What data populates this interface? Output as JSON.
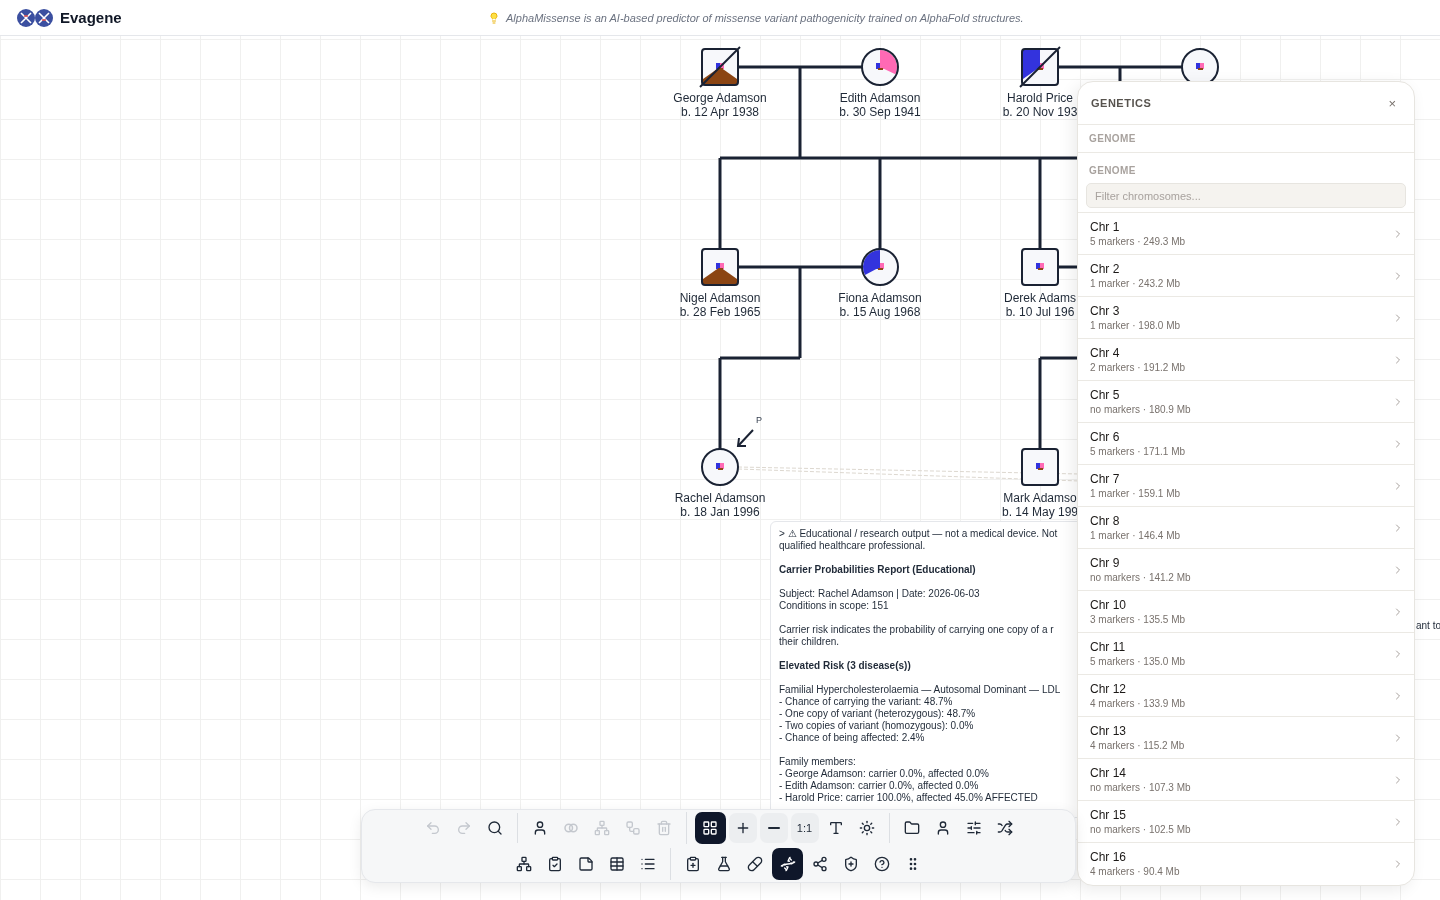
{
  "header": {
    "logo": "Evagene",
    "tip": "AlphaMissense is an AI-based predictor of missense variant pathogenicity trained on AlphaFold structures."
  },
  "pedigree": {
    "individuals": [
      {
        "name": "George Adamson",
        "birth": "b. 12 Apr 1938",
        "kind": "male",
        "deceased": true,
        "shading": {
          "kind": "bottom",
          "color": "#8b4513"
        }
      },
      {
        "name": "Edith Adamson",
        "birth": "b. 30 Sep 1941",
        "kind": "female",
        "deceased": false,
        "shading": {
          "kind": "top-right",
          "color": "#ff69b4"
        }
      },
      {
        "name": "Harold Price",
        "birth": "b. 20 Nov 193",
        "kind": "male",
        "deceased": true,
        "shading": {
          "kind": "top-left",
          "color": "#3333dd"
        }
      },
      {
        "kind": "female",
        "deceased": false
      },
      {
        "name": "Nigel Adamson",
        "birth": "b. 28 Feb 1965",
        "kind": "male",
        "deceased": false,
        "shading": {
          "kind": "bottom",
          "color": "#8b4513"
        }
      },
      {
        "name": "Fiona Adamson",
        "birth": "b. 15 Aug 1968",
        "kind": "female",
        "deceased": false,
        "shading": {
          "kind": "top-left",
          "color": "#3333dd"
        }
      },
      {
        "name": "Derek Adams",
        "birth": "b. 10 Jul 196",
        "kind": "male",
        "deceased": false
      },
      {
        "name": "Rachel Adamson",
        "birth": "b. 18 Jan 1996",
        "kind": "female",
        "deceased": false,
        "proband": true,
        "proband_label": "P"
      },
      {
        "name": "Mark Adamso",
        "birth": "b. 14 May 199",
        "kind": "male",
        "deceased": false
      }
    ]
  },
  "report": {
    "blocks": [
      {
        "kind": "paragraph",
        "lines": [
          "> ⚠ Educational / research output — not a medical device. Not",
          "qualified healthcare professional."
        ]
      },
      {
        "kind": "heading",
        "lines": [
          "Carrier Probabilities Report (Educational)"
        ]
      },
      {
        "kind": "paragraph",
        "lines": [
          "Subject: Rachel Adamson | Date: 2026-06-03",
          "Conditions in scope: 151"
        ]
      },
      {
        "kind": "paragraph",
        "lines": [
          "Carrier risk indicates the probability of carrying one copy of a r",
          "their children."
        ]
      },
      {
        "kind": "heading",
        "lines": [
          "Elevated Risk (3 disease(s))"
        ]
      },
      {
        "kind": "paragraph",
        "lines": [
          "Familial Hypercholesterolaemia — Autosomal Dominant — LDL",
          "- Chance of carrying the variant: 48.7%",
          "- One copy of variant (heterozygous): 48.7%",
          "- Two copies of variant (homozygous): 0.0%",
          "- Chance of being affected: 2.4%"
        ]
      },
      {
        "kind": "paragraph",
        "lines": [
          "Family members:",
          "- George Adamson: carrier 0.0%, affected 0.0%",
          "- Edith Adamson: carrier 0.0%, affected 0.0%",
          "- Harold Price: carrier 100.0%, affected 45.0% AFFECTED"
        ]
      }
    ],
    "overflow_fragment": "ant to"
  },
  "genetics": {
    "title": "GENETICS",
    "close": "×",
    "section": "GENOME",
    "label": "GENOME",
    "filter": {
      "placeholder": "Filter chromosomes..."
    },
    "chromosomes": [
      {
        "name": "Chr 1",
        "detail": "5 markers · 249.3 Mb"
      },
      {
        "name": "Chr 2",
        "detail": "1 marker · 243.2 Mb"
      },
      {
        "name": "Chr 3",
        "detail": "1 marker · 198.0 Mb"
      },
      {
        "name": "Chr 4",
        "detail": "2 markers · 191.2 Mb"
      },
      {
        "name": "Chr 5",
        "detail": "no markers · 180.9 Mb"
      },
      {
        "name": "Chr 6",
        "detail": "5 markers · 171.1 Mb"
      },
      {
        "name": "Chr 7",
        "detail": "1 marker · 159.1 Mb"
      },
      {
        "name": "Chr 8",
        "detail": "1 marker · 146.4 Mb"
      },
      {
        "name": "Chr 9",
        "detail": "no markers · 141.2 Mb"
      },
      {
        "name": "Chr 10",
        "detail": "3 markers · 135.5 Mb"
      },
      {
        "name": "Chr 11",
        "detail": "5 markers · 135.0 Mb"
      },
      {
        "name": "Chr 12",
        "detail": "4 markers · 133.9 Mb"
      },
      {
        "name": "Chr 13",
        "detail": "4 markers · 115.2 Mb"
      },
      {
        "name": "Chr 14",
        "detail": "no markers · 107.3 Mb"
      },
      {
        "name": "Chr 15",
        "detail": "no markers · 102.5 Mb"
      },
      {
        "name": "Chr 16",
        "detail": "4 markers · 90.4 Mb"
      }
    ]
  },
  "toolbar": {
    "rows": [
      [
        {
          "kind": "plain",
          "buttons": [
            {
              "disabled": true,
              "selected": false
            },
            {
              "disabled": true,
              "selected": false
            },
            {
              "disabled": false,
              "selected": false
            }
          ]
        },
        {
          "kind": "plain",
          "buttons": [
            {
              "disabled": false,
              "selected": false
            },
            {
              "disabled": true,
              "selected": false
            },
            {
              "disabled": true,
              "selected": false
            },
            {
              "disabled": true,
              "selected": false
            },
            {
              "disabled": true,
              "selected": false
            }
          ]
        },
        {
          "kind": "zoom",
          "buttons": [
            {
              "disabled": false,
              "selected": true
            },
            {
              "disabled": false,
              "selected": false
            },
            {
              "disabled": false,
              "selected": false
            },
            {
              "disabled": false,
              "selected": false,
              "label": "1:1"
            },
            {
              "disabled": false,
              "selected": false
            },
            {
              "disabled": false,
              "selected": false
            }
          ]
        },
        {
          "kind": "plain",
          "buttons": [
            {
              "disabled": false,
              "selected": false
            },
            {
              "disabled": false,
              "selected": false
            },
            {
              "disabled": false,
              "selected": false
            },
            {
              "disabled": false,
              "selected": false
            }
          ]
        }
      ],
      [
        {
          "kind": "plain",
          "buttons": [
            {
              "disabled": false,
              "selected": false
            },
            {
              "disabled": false,
              "selected": false
            },
            {
              "disabled": false,
              "selected": false
            },
            {
              "disabled": false,
              "selected": false
            },
            {
              "disabled": false,
              "selected": false
            }
          ]
        },
        {
          "kind": "plain",
          "buttons": [
            {
              "disabled": false,
              "selected": false
            },
            {
              "disabled": false,
              "selected": false
            },
            {
              "disabled": false,
              "selected": false
            },
            {
              "disabled": false,
              "selected": true
            },
            {
              "disabled": false,
              "selected": false
            },
            {
              "disabled": false,
              "selected": false
            },
            {
              "disabled": false,
              "selected": false
            },
            {
              "disabled": false,
              "selected": false
            }
          ]
        }
      ]
    ]
  }
}
